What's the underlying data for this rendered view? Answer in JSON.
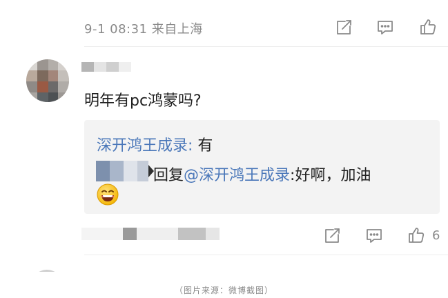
{
  "post": {
    "timestamp": "9-1 08:31 来自上海",
    "actions": {
      "share_icon": "share-icon",
      "comment_icon": "comment-icon",
      "like_icon": "like-icon"
    }
  },
  "comment": {
    "text": "明年有pc鸿蒙吗?",
    "replies": [
      {
        "author": "深开鸿王成录",
        "separator": ": ",
        "text": "有"
      },
      {
        "verb": "回复",
        "mention": "@深开鸿王成录",
        "text": ":好啊，加油",
        "emoji": "grinning-face-emoji"
      }
    ],
    "like_count": "6"
  },
  "caption": "（图片来源：微博截图）",
  "colors": {
    "link": "#4a77b9",
    "meta": "#8a8a8a",
    "reply_bg": "#f3f3f3"
  }
}
